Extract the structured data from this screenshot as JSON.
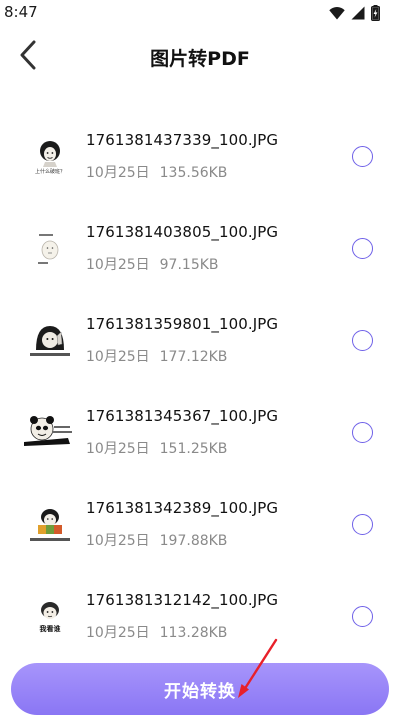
{
  "status_bar": {
    "time": "8:47",
    "icons": [
      "wifi-icon",
      "cellular-signal-icon",
      "battery-charging-icon"
    ]
  },
  "header": {
    "title": "图片转PDF",
    "back_icon": "chevron-left-icon"
  },
  "files": [
    {
      "name": "1761381437339_100.JPG",
      "date": "10月25日",
      "size": "135.56KB",
      "selected": false,
      "thumb_caption": "上什么破班？"
    },
    {
      "name": "1761381403805_100.JPG",
      "date": "10月25日",
      "size": "97.15KB",
      "selected": false,
      "thumb_caption": ""
    },
    {
      "name": "1761381359801_100.JPG",
      "date": "10月25日",
      "size": "177.12KB",
      "selected": false,
      "thumb_caption": ""
    },
    {
      "name": "1761381345367_100.JPG",
      "date": "10月25日",
      "size": "151.25KB",
      "selected": false,
      "thumb_caption": ""
    },
    {
      "name": "1761381342389_100.JPG",
      "date": "10月25日",
      "size": "197.88KB",
      "selected": false,
      "thumb_caption": ""
    },
    {
      "name": "1761381312142_100.JPG",
      "date": "10月25日",
      "size": "113.28KB",
      "selected": false,
      "thumb_caption": "我看谁"
    }
  ],
  "bottom": {
    "convert_label": "开始转换"
  },
  "colors": {
    "accent": "#7b6cf0",
    "button_gradient_top": "#a795fb",
    "button_gradient_bottom": "#8a76f4",
    "annotation_arrow": "#e8202a"
  }
}
